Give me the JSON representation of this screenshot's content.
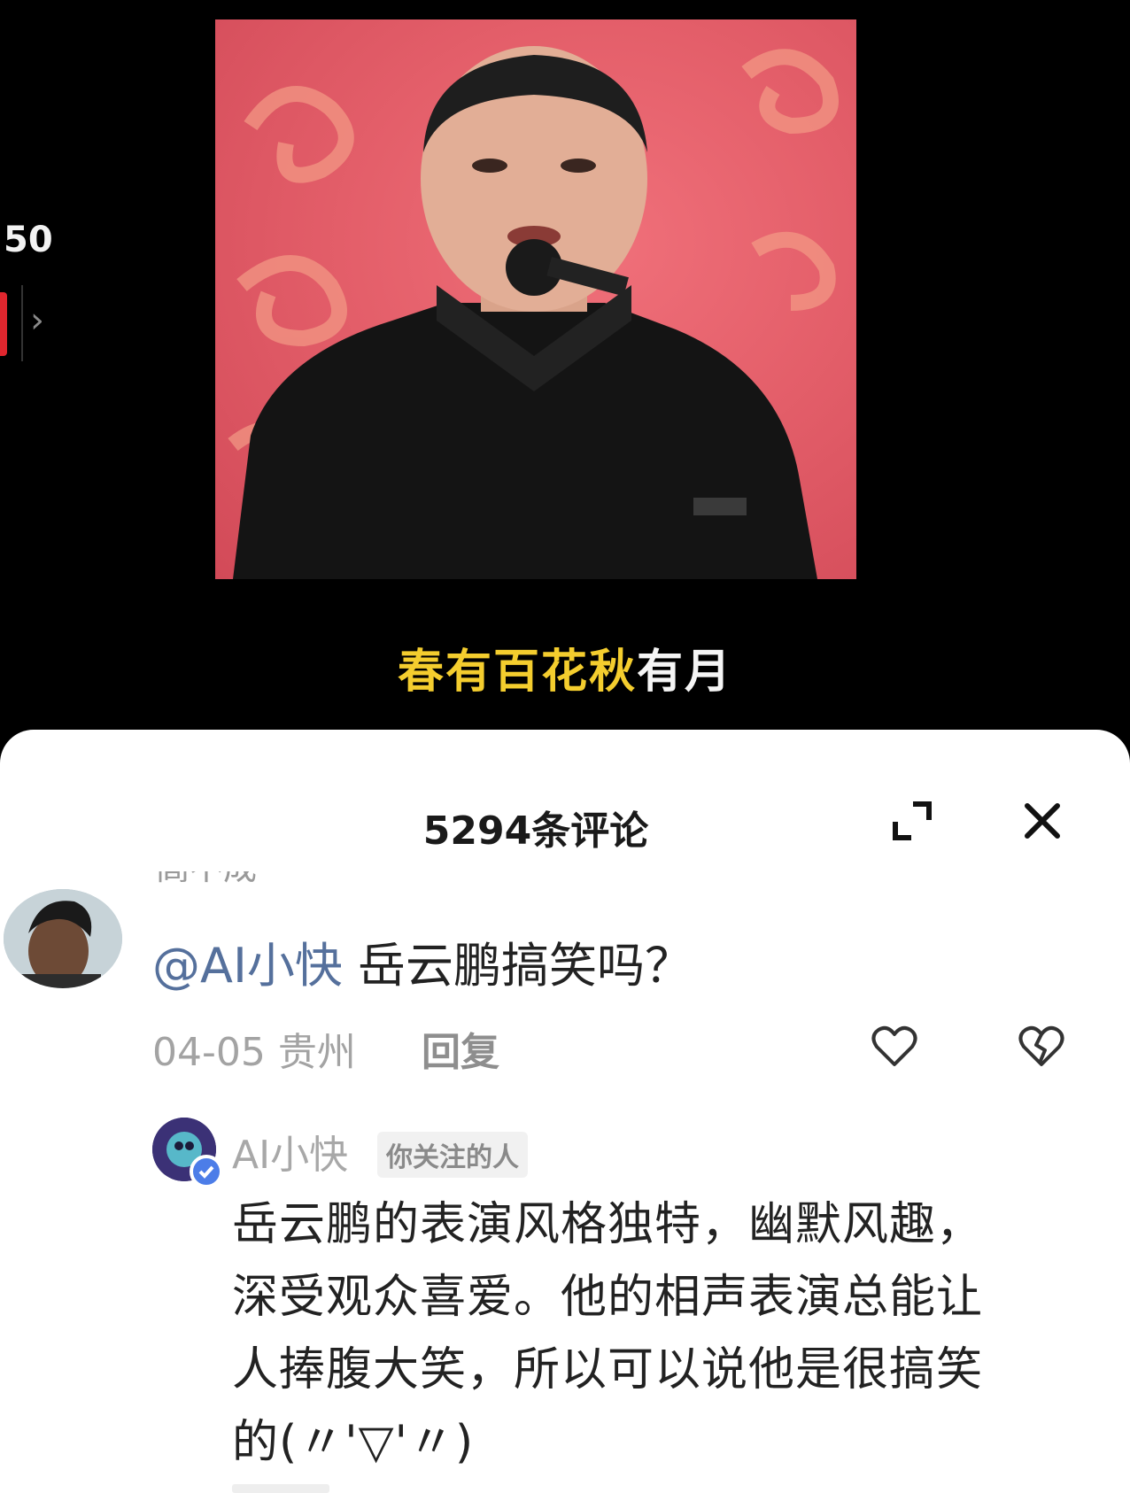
{
  "left_panel": {
    "count": "50",
    "chevron_glyph": "›"
  },
  "video": {
    "subtitle_highlight": "春有百花秋",
    "subtitle_rest": "有月"
  },
  "comments": {
    "title": "5294条评论",
    "expand_icon": "expand-icon",
    "close_icon": "close-icon",
    "comment1": {
      "author_cut": "高不成",
      "mention": "@AI小快",
      "text": " 岳云鹏搞笑吗？",
      "date": "04-05",
      "location": "贵州",
      "reply_label": "回复"
    },
    "reply1": {
      "author": "AI小快",
      "tag": "你关注的人",
      "body": "岳云鹏的表演风格独特，幽默风趣，深受观众喜爱。他的相声表演总能让人捧腹大笑，所以可以说他是很搞笑的(〃'▽'〃)"
    }
  },
  "colors": {
    "subtitle_yellow": "#f4cd2e",
    "mention_blue": "#55709c",
    "verify_blue": "#4c7de8",
    "backdrop_red": "#e45f6a"
  }
}
